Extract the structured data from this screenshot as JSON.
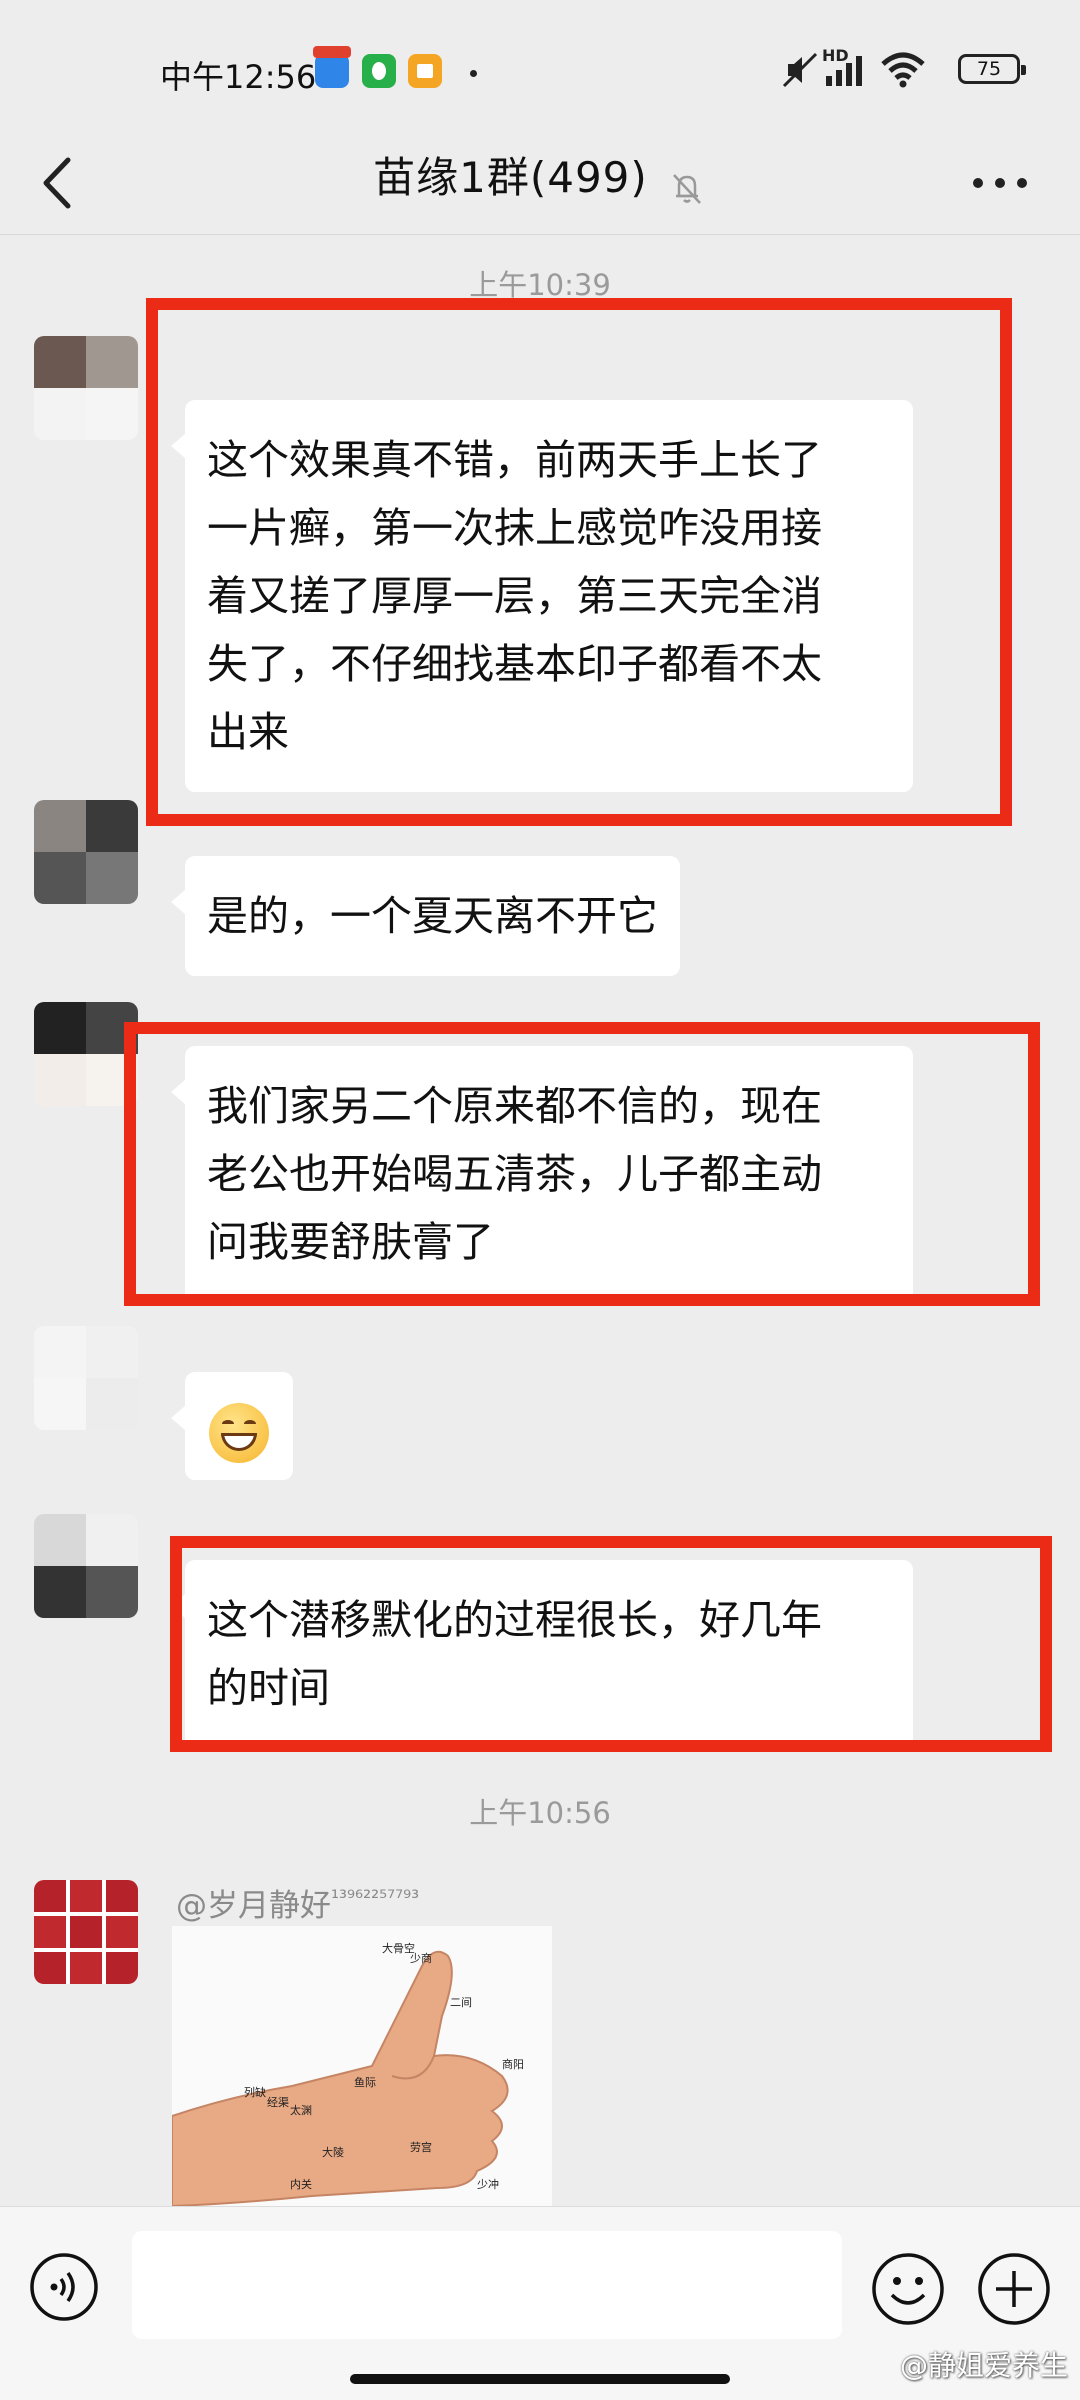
{
  "status_bar": {
    "time": "中午12:56",
    "battery": "75",
    "network_badge": "HD"
  },
  "nav": {
    "title": "苗缘1群(499)"
  },
  "chat": {
    "time_labels": [
      "上午10:39",
      "上午10:56"
    ],
    "messages": [
      {
        "text_lines": [
          "这个效果真不错，前两天手上长了",
          "一片癣，第一次抹上感觉咋没用接",
          "着又搓了厚厚一层，第三天完全消",
          "失了，不仔细找基本印子都看不太",
          "出来"
        ]
      },
      {
        "text_lines": [
          "是的，一个夏天离不开它"
        ]
      },
      {
        "text_lines": [
          "我们家另二个原来都不信的，现在",
          "老公也开始喝五清茶，儿子都主动",
          "问我要舒肤膏了"
        ]
      },
      {
        "emoji": "grinning-face"
      },
      {
        "text_lines": [
          "这个潜移默化的过程很长，好几年",
          "的时间"
        ]
      }
    ],
    "last_sender": {
      "name": "@岁月静好",
      "suffix": "¹³⁹⁶²²⁵⁷⁷⁹³"
    },
    "image_labels": [
      "少商",
      "二间",
      "商阳",
      "太渊",
      "列缺",
      "经渠",
      "劳宫",
      "鱼际",
      "大陵",
      "内关",
      "少冲",
      "大骨空"
    ]
  },
  "input": {
    "placeholder": ""
  },
  "watermark": "@静姐爱养生",
  "colors": {
    "background": "#ededed",
    "bubble": "#ffffff",
    "highlight": "#ec2b17"
  }
}
